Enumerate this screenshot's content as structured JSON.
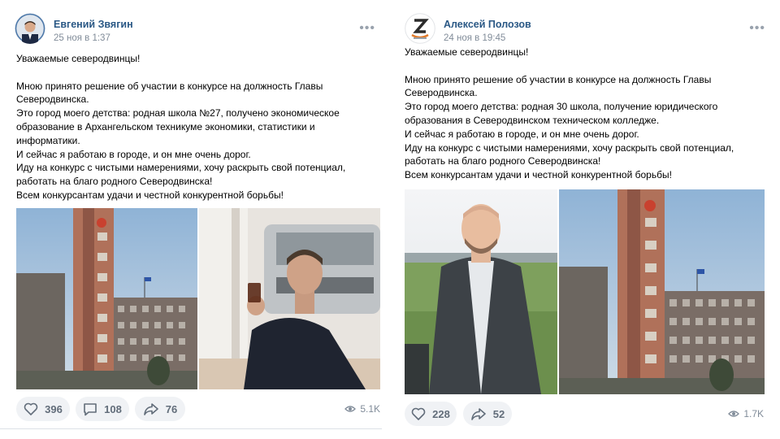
{
  "posts": [
    {
      "author": "Евгений Звягин",
      "date": "25 ноя в 1:37",
      "more_icon": "more-horizontal-icon",
      "text": {
        "greeting": "Уважаемые северодвинцы!",
        "lines": [
          "Мною принято решение об участии в конкурсе на должность Главы Северодвинска.",
          "Это город моего детства: родная школа №27, получено экономическое образование в Архангельском техникуме экономики, статистики и информатики.",
          "И сейчас я работаю в городе, и он мне очень дорог.",
          "Иду на конкурс с чистыми намерениями, хочу раскрыть свой потенциал, работать на благо родного Северодвинска!",
          "Всем конкурсантам удачи и честной конкурентной борьбы!"
        ]
      },
      "photos": [
        "city-administration-building",
        "man-with-glass-near-car"
      ],
      "likes": "396",
      "comments": "108",
      "reposts": "76",
      "views": "5.1K"
    },
    {
      "author": "Алексей Полозов",
      "date": "24 ноя в 19:45",
      "more_icon": "more-horizontal-icon",
      "text": {
        "greeting": "Уважаемые северодвинцы!",
        "lines": [
          "Мною принято решение об участии в конкурсе на должность Главы Северодвинска.",
          "Это город моего детства: родная 30 школа, получение юридического образования в Северодвинском техническом колледже.",
          "И сейчас я работаю в городе, и он мне очень дорог.",
          "Иду на конкурс с чистыми намерениями, хочу раскрыть свой потенциал, работать на благо родного Северодвинска!",
          "Всем конкурсантам удачи и честной конкурентной борьбы!"
        ]
      },
      "photos": [
        "man-in-suit-portrait",
        "city-administration-building"
      ],
      "likes": "228",
      "reposts": "52",
      "views": "1.7K"
    }
  ],
  "colors": {
    "author": "#2a5885",
    "meta": "#818c99",
    "pill_bg": "#f0f2f5",
    "pill_text": "#626d7a"
  }
}
